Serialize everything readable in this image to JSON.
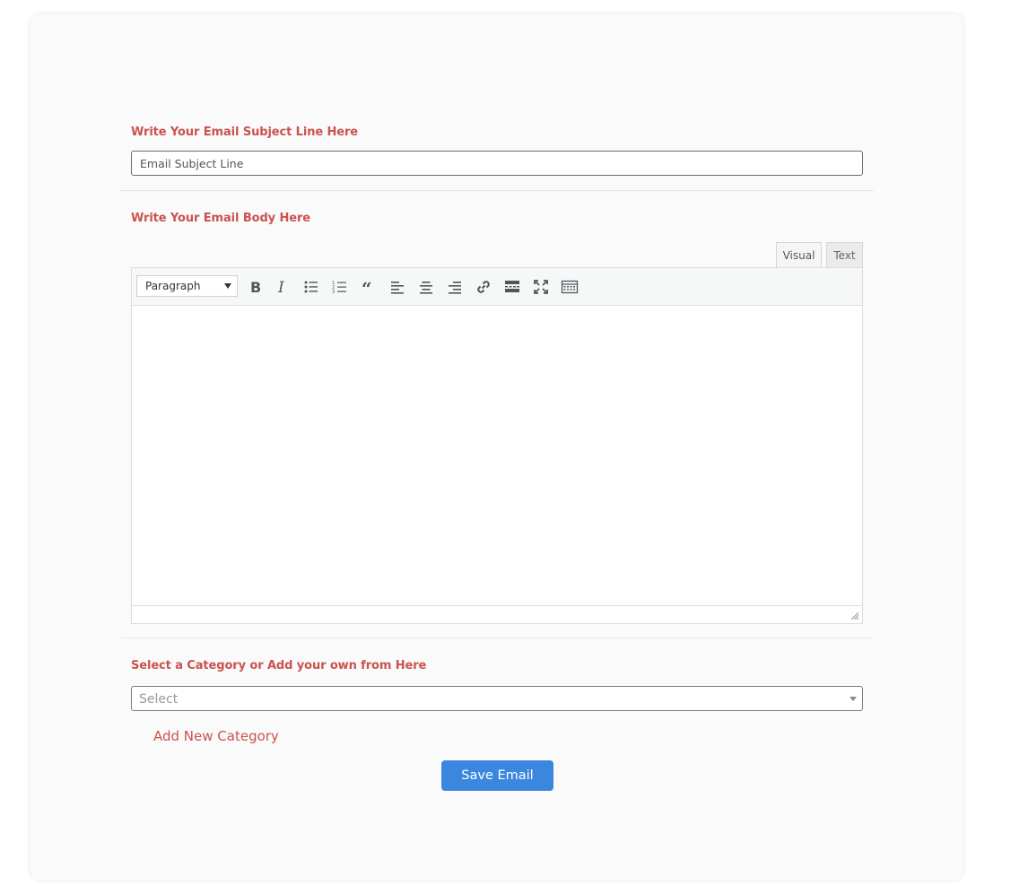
{
  "subject": {
    "label": "Write Your Email Subject Line Here",
    "placeholder": "Email Subject Line",
    "value": ""
  },
  "body": {
    "label": "Write Your Email Body Here",
    "tabs": {
      "visual": "Visual",
      "text": "Text"
    },
    "format_select": "Paragraph",
    "toolbar_icons": [
      "bold-icon",
      "italic-icon",
      "bulleted-list-icon",
      "numbered-list-icon",
      "blockquote-icon",
      "align-left-icon",
      "align-center-icon",
      "align-right-icon",
      "link-icon",
      "read-more-icon",
      "fullscreen-icon",
      "toolbar-toggle-icon"
    ]
  },
  "category": {
    "label": "Select a Category or Add your own from Here",
    "selected": "Select",
    "add_new_label": "Add New Category"
  },
  "actions": {
    "save_label": "Save Email"
  },
  "colors": {
    "label": "#c9534f",
    "primary_button": "#3b87e0",
    "card_bg": "#fafafa"
  }
}
